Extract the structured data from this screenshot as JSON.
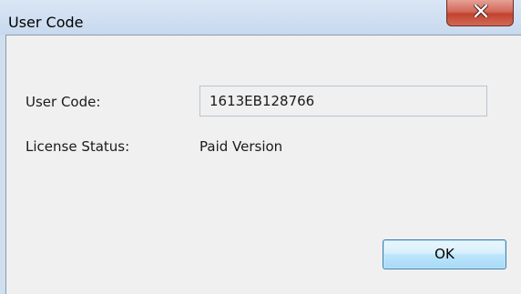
{
  "window": {
    "title": "User Code",
    "close_icon": "close-icon"
  },
  "form": {
    "user_code_label": "User Code:",
    "user_code_value": "1613EB128766",
    "license_label": "License Status:",
    "license_value": "Paid Version"
  },
  "buttons": {
    "ok_label": "OK"
  }
}
